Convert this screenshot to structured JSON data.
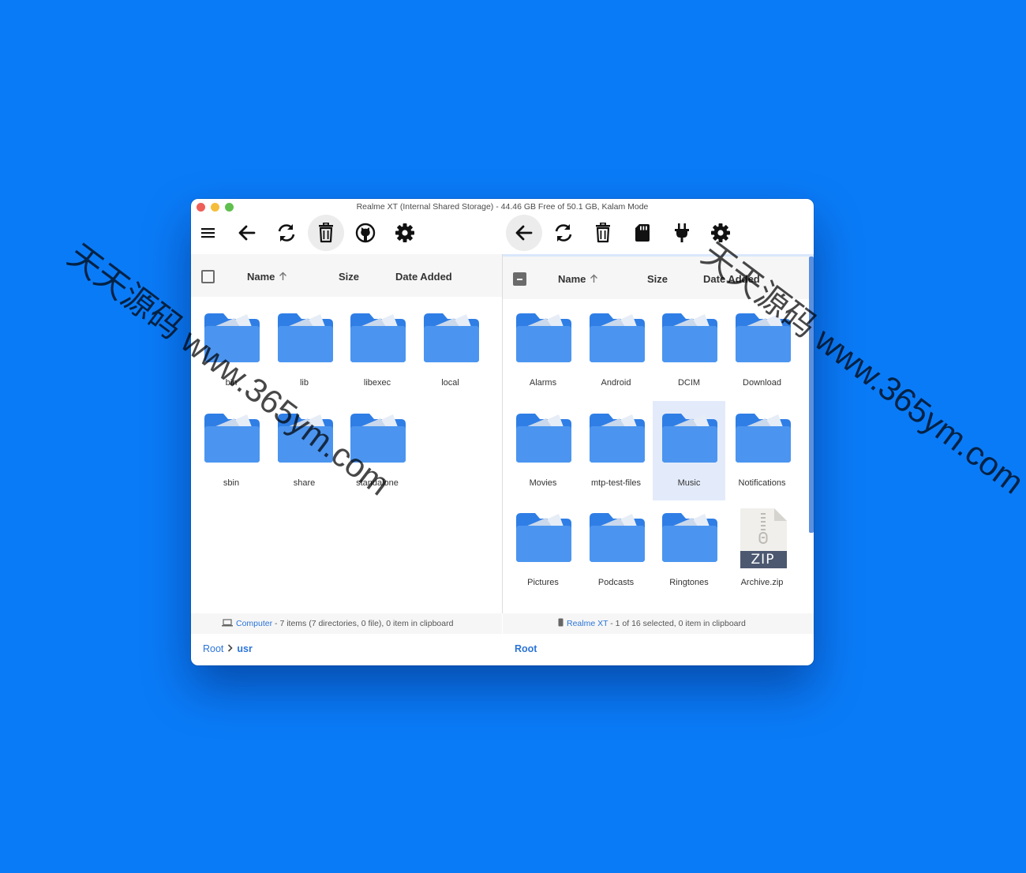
{
  "window": {
    "title": "Realme XT (Internal Shared Storage) - 44.46 GB Free of 50.1 GB, Kalam Mode"
  },
  "toolbar_left": {
    "menu_icon": "hamburger-menu-icon",
    "back_icon": "arrow-left-icon",
    "refresh_icon": "refresh-icon",
    "delete_icon": "trash-icon",
    "github_icon": "github-icon",
    "settings_icon": "gear-icon"
  },
  "toolbar_right": {
    "back_icon": "arrow-left-icon",
    "refresh_icon": "refresh-icon",
    "delete_icon": "trash-icon",
    "sdcard_icon": "sd-card-icon",
    "plug_icon": "plug-icon",
    "settings_icon": "gear-icon"
  },
  "left_pane": {
    "columns": {
      "name": "Name",
      "size": "Size",
      "date": "Date Added"
    },
    "items": [
      {
        "label": "bin",
        "type": "folder"
      },
      {
        "label": "lib",
        "type": "folder"
      },
      {
        "label": "libexec",
        "type": "folder"
      },
      {
        "label": "local",
        "type": "folder"
      },
      {
        "label": "sbin",
        "type": "folder"
      },
      {
        "label": "share",
        "type": "folder"
      },
      {
        "label": "standalone",
        "type": "folder"
      }
    ],
    "status": {
      "device": "Computer",
      "text": " - 7 items (7 directories, 0 file), 0 item in clipboard"
    },
    "breadcrumb": {
      "root": "Root",
      "current": "usr"
    }
  },
  "right_pane": {
    "columns": {
      "name": "Name",
      "size": "Size",
      "date": "Date Added"
    },
    "items": [
      {
        "label": "Alarms",
        "type": "folder"
      },
      {
        "label": "Android",
        "type": "folder"
      },
      {
        "label": "DCIM",
        "type": "folder"
      },
      {
        "label": "Download",
        "type": "folder"
      },
      {
        "label": "Movies",
        "type": "folder"
      },
      {
        "label": "mtp-test-files",
        "type": "folder"
      },
      {
        "label": "Music",
        "type": "folder",
        "selected": true
      },
      {
        "label": "Notifications",
        "type": "folder"
      },
      {
        "label": "Pictures",
        "type": "folder"
      },
      {
        "label": "Podcasts",
        "type": "folder"
      },
      {
        "label": "Ringtones",
        "type": "folder"
      },
      {
        "label": "Archive.zip",
        "type": "zip",
        "badge": "ZIP"
      }
    ],
    "status": {
      "device": "Realme XT",
      "text": " - 1 of 16 selected, 0 item in clipboard"
    },
    "breadcrumb": {
      "root": "Root"
    }
  },
  "watermark": {
    "text": "天天源码 www.365ym.com"
  },
  "colors": {
    "background": "#0a7bf7",
    "folder_dark": "#2f7ee6",
    "folder_light": "#4b95f0",
    "link": "#2b74d8",
    "selected_tile": "#e3ebfa"
  }
}
